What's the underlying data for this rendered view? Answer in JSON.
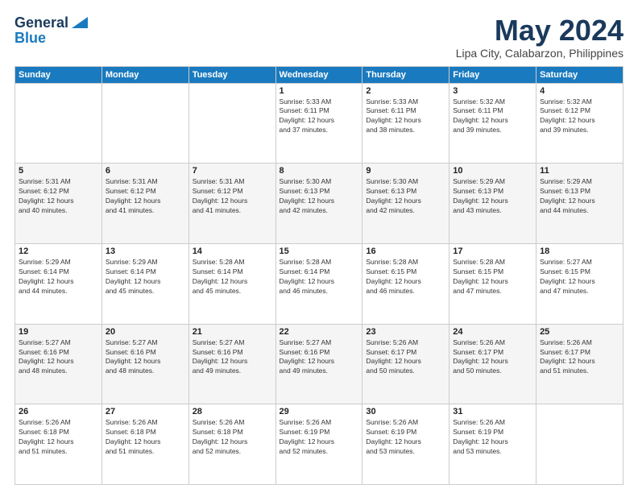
{
  "logo": {
    "line1": "General",
    "line2": "Blue"
  },
  "title": "May 2024",
  "subtitle": "Lipa City, Calabarzon, Philippines",
  "days_header": [
    "Sunday",
    "Monday",
    "Tuesday",
    "Wednesday",
    "Thursday",
    "Friday",
    "Saturday"
  ],
  "weeks": [
    [
      {
        "day": "",
        "info": ""
      },
      {
        "day": "",
        "info": ""
      },
      {
        "day": "",
        "info": ""
      },
      {
        "day": "1",
        "info": "Sunrise: 5:33 AM\nSunset: 6:11 PM\nDaylight: 12 hours\nand 37 minutes."
      },
      {
        "day": "2",
        "info": "Sunrise: 5:33 AM\nSunset: 6:11 PM\nDaylight: 12 hours\nand 38 minutes."
      },
      {
        "day": "3",
        "info": "Sunrise: 5:32 AM\nSunset: 6:11 PM\nDaylight: 12 hours\nand 39 minutes."
      },
      {
        "day": "4",
        "info": "Sunrise: 5:32 AM\nSunset: 6:12 PM\nDaylight: 12 hours\nand 39 minutes."
      }
    ],
    [
      {
        "day": "5",
        "info": "Sunrise: 5:31 AM\nSunset: 6:12 PM\nDaylight: 12 hours\nand 40 minutes."
      },
      {
        "day": "6",
        "info": "Sunrise: 5:31 AM\nSunset: 6:12 PM\nDaylight: 12 hours\nand 41 minutes."
      },
      {
        "day": "7",
        "info": "Sunrise: 5:31 AM\nSunset: 6:12 PM\nDaylight: 12 hours\nand 41 minutes."
      },
      {
        "day": "8",
        "info": "Sunrise: 5:30 AM\nSunset: 6:13 PM\nDaylight: 12 hours\nand 42 minutes."
      },
      {
        "day": "9",
        "info": "Sunrise: 5:30 AM\nSunset: 6:13 PM\nDaylight: 12 hours\nand 42 minutes."
      },
      {
        "day": "10",
        "info": "Sunrise: 5:29 AM\nSunset: 6:13 PM\nDaylight: 12 hours\nand 43 minutes."
      },
      {
        "day": "11",
        "info": "Sunrise: 5:29 AM\nSunset: 6:13 PM\nDaylight: 12 hours\nand 44 minutes."
      }
    ],
    [
      {
        "day": "12",
        "info": "Sunrise: 5:29 AM\nSunset: 6:14 PM\nDaylight: 12 hours\nand 44 minutes."
      },
      {
        "day": "13",
        "info": "Sunrise: 5:29 AM\nSunset: 6:14 PM\nDaylight: 12 hours\nand 45 minutes."
      },
      {
        "day": "14",
        "info": "Sunrise: 5:28 AM\nSunset: 6:14 PM\nDaylight: 12 hours\nand 45 minutes."
      },
      {
        "day": "15",
        "info": "Sunrise: 5:28 AM\nSunset: 6:14 PM\nDaylight: 12 hours\nand 46 minutes."
      },
      {
        "day": "16",
        "info": "Sunrise: 5:28 AM\nSunset: 6:15 PM\nDaylight: 12 hours\nand 46 minutes."
      },
      {
        "day": "17",
        "info": "Sunrise: 5:28 AM\nSunset: 6:15 PM\nDaylight: 12 hours\nand 47 minutes."
      },
      {
        "day": "18",
        "info": "Sunrise: 5:27 AM\nSunset: 6:15 PM\nDaylight: 12 hours\nand 47 minutes."
      }
    ],
    [
      {
        "day": "19",
        "info": "Sunrise: 5:27 AM\nSunset: 6:16 PM\nDaylight: 12 hours\nand 48 minutes."
      },
      {
        "day": "20",
        "info": "Sunrise: 5:27 AM\nSunset: 6:16 PM\nDaylight: 12 hours\nand 48 minutes."
      },
      {
        "day": "21",
        "info": "Sunrise: 5:27 AM\nSunset: 6:16 PM\nDaylight: 12 hours\nand 49 minutes."
      },
      {
        "day": "22",
        "info": "Sunrise: 5:27 AM\nSunset: 6:16 PM\nDaylight: 12 hours\nand 49 minutes."
      },
      {
        "day": "23",
        "info": "Sunrise: 5:26 AM\nSunset: 6:17 PM\nDaylight: 12 hours\nand 50 minutes."
      },
      {
        "day": "24",
        "info": "Sunrise: 5:26 AM\nSunset: 6:17 PM\nDaylight: 12 hours\nand 50 minutes."
      },
      {
        "day": "25",
        "info": "Sunrise: 5:26 AM\nSunset: 6:17 PM\nDaylight: 12 hours\nand 51 minutes."
      }
    ],
    [
      {
        "day": "26",
        "info": "Sunrise: 5:26 AM\nSunset: 6:18 PM\nDaylight: 12 hours\nand 51 minutes."
      },
      {
        "day": "27",
        "info": "Sunrise: 5:26 AM\nSunset: 6:18 PM\nDaylight: 12 hours\nand 51 minutes."
      },
      {
        "day": "28",
        "info": "Sunrise: 5:26 AM\nSunset: 6:18 PM\nDaylight: 12 hours\nand 52 minutes."
      },
      {
        "day": "29",
        "info": "Sunrise: 5:26 AM\nSunset: 6:19 PM\nDaylight: 12 hours\nand 52 minutes."
      },
      {
        "day": "30",
        "info": "Sunrise: 5:26 AM\nSunset: 6:19 PM\nDaylight: 12 hours\nand 53 minutes."
      },
      {
        "day": "31",
        "info": "Sunrise: 5:26 AM\nSunset: 6:19 PM\nDaylight: 12 hours\nand 53 minutes."
      },
      {
        "day": "",
        "info": ""
      }
    ]
  ]
}
